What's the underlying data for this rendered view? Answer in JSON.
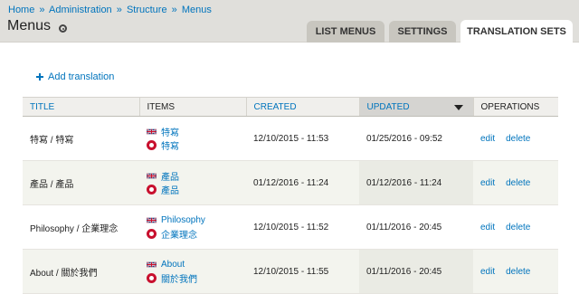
{
  "breadcrumb": {
    "home": "Home",
    "administration": "Administration",
    "structure": "Structure",
    "menus": "Menus",
    "separator": "»"
  },
  "page": {
    "title": "Menus"
  },
  "tabs": [
    {
      "label": "LIST MENUS",
      "active": false
    },
    {
      "label": "SETTINGS",
      "active": false
    },
    {
      "label": "TRANSLATION SETS",
      "active": true
    }
  ],
  "actions": {
    "add_translation": "Add translation"
  },
  "table": {
    "headers": {
      "title": "TITLE",
      "items": "ITEMS",
      "created": "CREATED",
      "updated": "UPDATED",
      "operations": "OPERATIONS"
    },
    "sorted_column": "updated",
    "sort_direction": "descending",
    "rows": [
      {
        "title": "特寫 / 特寫",
        "items": [
          {
            "lang": "en",
            "label": "特寫"
          },
          {
            "lang": "zh-hant",
            "label": "特寫"
          }
        ],
        "created": "12/10/2015 - 11:53",
        "updated": "01/25/2016 - 09:52",
        "edit": "edit",
        "delete": "delete"
      },
      {
        "title": "產品 / 產品",
        "items": [
          {
            "lang": "en",
            "label": "產品"
          },
          {
            "lang": "zh-hant",
            "label": "產品"
          }
        ],
        "created": "01/12/2016 - 11:24",
        "updated": "01/12/2016 - 11:24",
        "edit": "edit",
        "delete": "delete"
      },
      {
        "title": "Philosophy / 企業理念",
        "items": [
          {
            "lang": "en",
            "label": "Philosophy"
          },
          {
            "lang": "zh-hant",
            "label": "企業理念"
          }
        ],
        "created": "12/10/2015 - 11:52",
        "updated": "01/11/2016 - 20:45",
        "edit": "edit",
        "delete": "delete"
      },
      {
        "title": "About / 關於我們",
        "items": [
          {
            "lang": "en",
            "label": "About"
          },
          {
            "lang": "zh-hant",
            "label": "關於我們"
          }
        ],
        "created": "12/10/2015 - 11:55",
        "updated": "01/11/2016 - 20:45",
        "edit": "edit",
        "delete": "delete"
      }
    ]
  },
  "colors": {
    "link": "#0074bd",
    "header_bg": "#e0dfdb",
    "tab_bg": "#c8c6bf",
    "sorted_header_bg": "#d5d4d1"
  }
}
